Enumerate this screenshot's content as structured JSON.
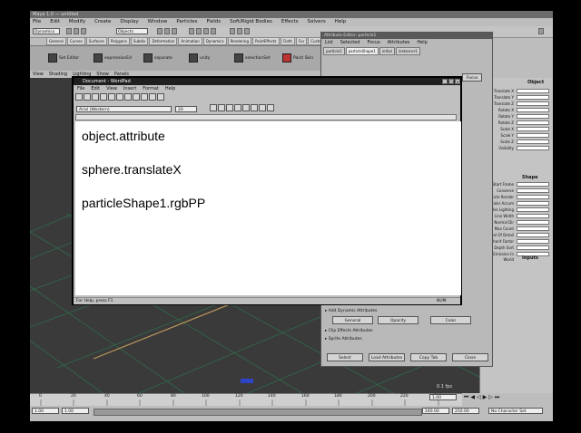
{
  "maya": {
    "title": "Maya 1.0 — untitled",
    "menus": [
      "File",
      "Edit",
      "Modify",
      "Create",
      "Display",
      "Window",
      "Particles",
      "Fields",
      "Soft/Rigid Bodies",
      "Effects",
      "Solvers",
      "Help"
    ],
    "mode_select": "Dynamics",
    "object_select": "Objects",
    "shelf_tabs": [
      "General",
      "Curves",
      "Surfaces",
      "Polygons",
      "Subdiv",
      "Deformation",
      "Animation",
      "Dynamics",
      "Rendering",
      "PaintEffects",
      "Cloth",
      "Fur",
      "Custom"
    ],
    "shelf_items": [
      "Set Editor",
      "expressionEd",
      "separate",
      "unity",
      "selectionSet",
      "Paint Skin"
    ],
    "panel_menus": [
      "View",
      "Shading",
      "Lighting",
      "Show",
      "Panels"
    ],
    "fps": "0.1 fps",
    "timeline_ticks": [
      "0",
      "20",
      "40",
      "60",
      "80",
      "100",
      "120",
      "140",
      "160",
      "180",
      "200",
      "220",
      "240"
    ],
    "range_start": "1.00",
    "range_inner_start": "1.00",
    "range_end": "240.00",
    "range_inner_end": "250.00",
    "current_frame": "1.00",
    "char_set": "No Character Set"
  },
  "channel_box": {
    "header": "Object",
    "channels": [
      "Translate X",
      "Translate Y",
      "Translate Z",
      "Rotate X",
      "Rotate Y",
      "Rotate Z",
      "Scale X",
      "Scale Y",
      "Scale Z",
      "Visibility"
    ],
    "shape_header": "Shape",
    "shape_channels": [
      "Start Frame",
      "Conserve",
      "Particle Render",
      "Color Accum",
      "Use Lighting",
      "Line Width",
      "Normal Dir",
      "Max Count",
      "Level Of Detail",
      "Inherit Factor",
      "Depth Sort",
      "Emission In World"
    ],
    "inputs_header": "Inputs"
  },
  "attribute_editor": {
    "title": "Attribute Editor: particle1",
    "menus": [
      "List",
      "Selected",
      "Focus",
      "Attributes",
      "Help"
    ],
    "tabs": [
      "particle1",
      "particleShape1",
      "initial",
      "instancer1"
    ],
    "focus_button": "Focus",
    "sections": [
      "Add Dynamic Attributes",
      "Clip Effects Attributes",
      "Sprite Attributes"
    ],
    "dyn_buttons": [
      "General",
      "Opacity",
      "Color"
    ],
    "bottom_buttons": [
      "Select",
      "Load Attributes",
      "Copy Tab",
      "Close"
    ]
  },
  "wordpad": {
    "title": "Document - WordPad",
    "menus": [
      "File",
      "Edit",
      "View",
      "Insert",
      "Format",
      "Help"
    ],
    "font": "Arial (Western)",
    "font_size": "20",
    "lines": [
      "object.attribute",
      "sphere.translateX",
      "particleShape1.rgbPP"
    ],
    "status": "For Help, press F1",
    "num_indicator": "NUM"
  }
}
